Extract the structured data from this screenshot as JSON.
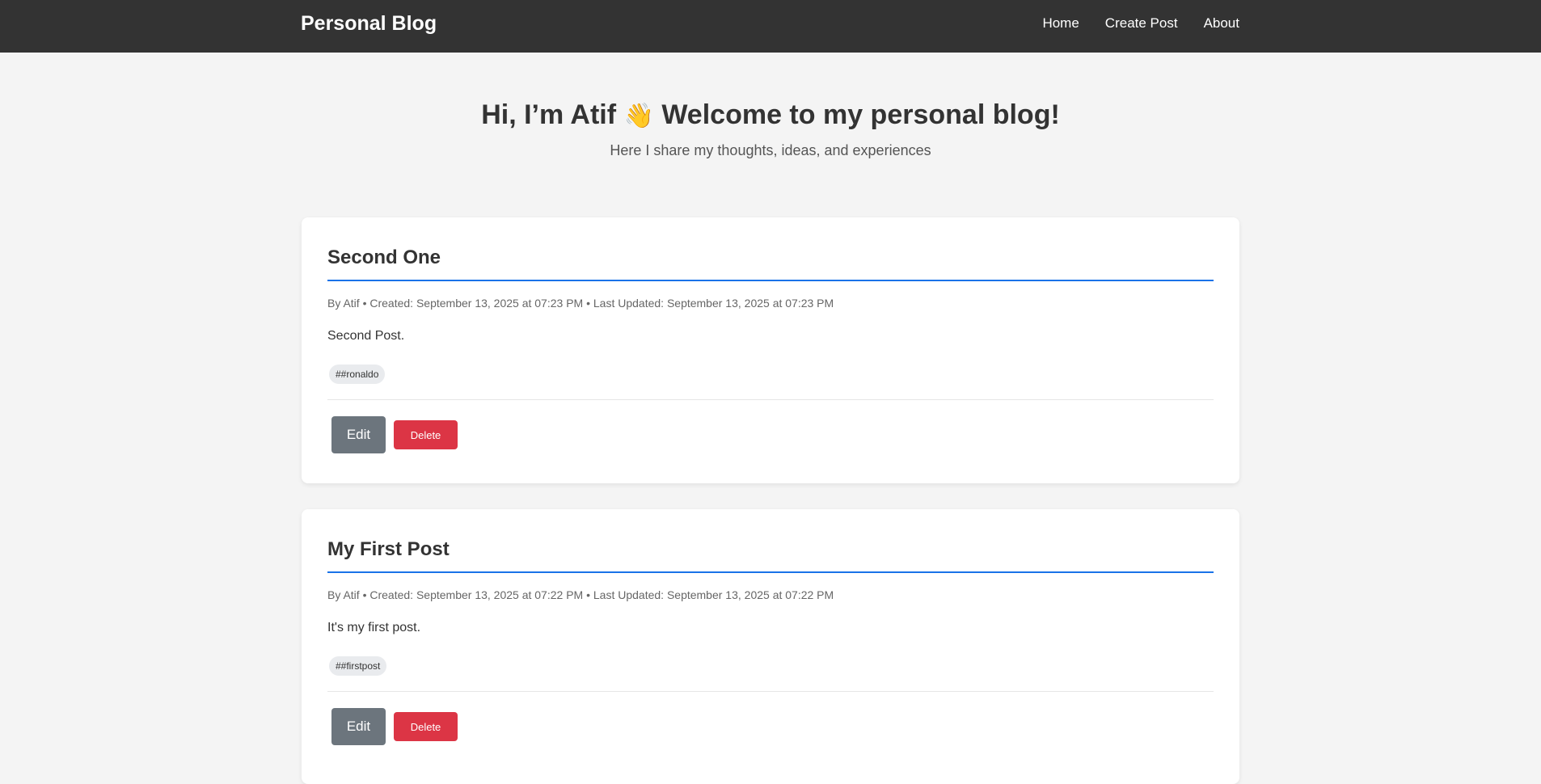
{
  "navbar": {
    "brand": "Personal Blog",
    "links": [
      "Home",
      "Create Post",
      "About"
    ]
  },
  "hero": {
    "title_before": "Hi, I’m Atif",
    "wave_icon": "👋",
    "title_after": "Welcome to my personal blog!",
    "subtitle": "Here I share my thoughts, ideas, and experiences"
  },
  "posts": [
    {
      "title": "Second One",
      "meta": "By Atif • Created: September 13, 2025 at 07:23 PM • Last Updated: September 13, 2025 at 07:23 PM",
      "body": "Second Post.",
      "tags": [
        "##ronaldo"
      ],
      "edit_label": "Edit",
      "delete_label": "Delete"
    },
    {
      "title": "My First Post",
      "meta": "By Atif • Created: September 13, 2025 at 07:22 PM • Last Updated: September 13, 2025 at 07:22 PM",
      "body": "It's my first post.",
      "tags": [
        "##firstpost"
      ],
      "edit_label": "Edit",
      "delete_label": "Delete"
    }
  ],
  "colors": {
    "navbar_bg": "#333333",
    "page_bg": "#f4f4f4",
    "title_underline": "#1a73e8",
    "edit_button": "#6c757d",
    "delete_button": "#dc3545"
  }
}
